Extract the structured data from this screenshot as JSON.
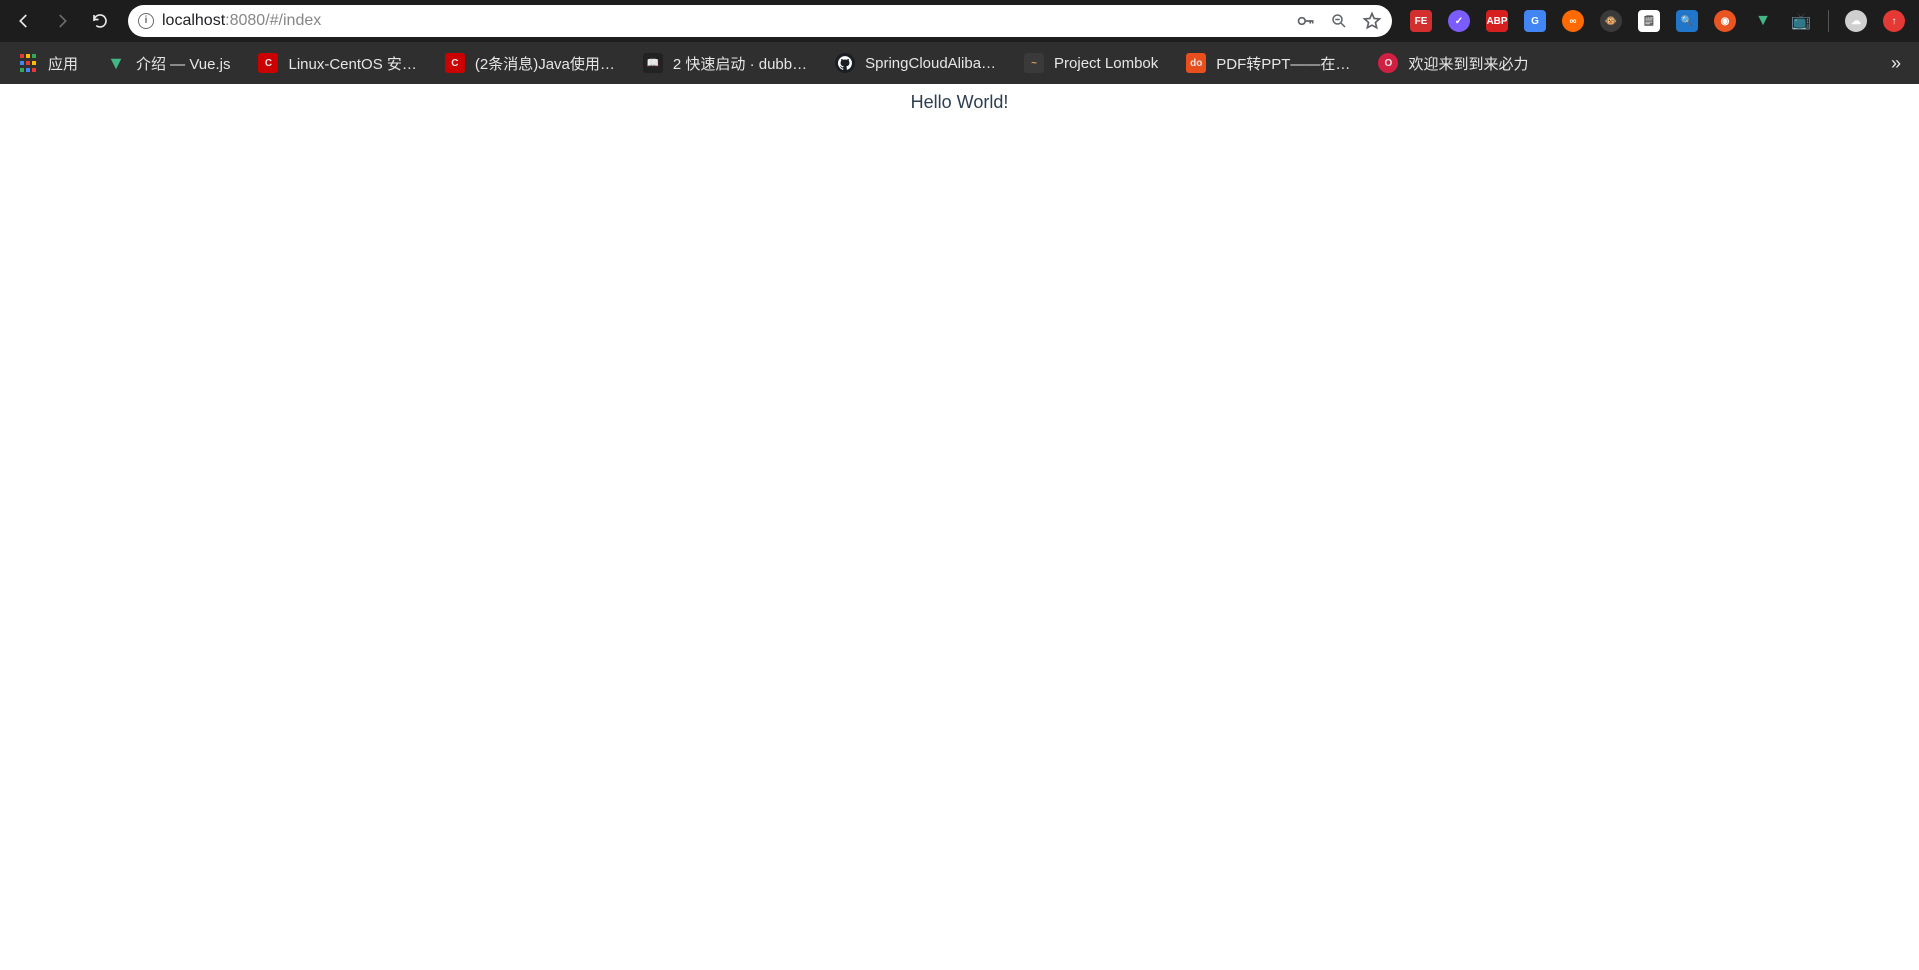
{
  "nav": {
    "url_prefix": "localhost",
    "url_suffix": ":8080/#/index"
  },
  "bookmarks": {
    "apps": "应用",
    "vue": "介绍 — Vue.js",
    "linux": "Linux-CentOS 安…",
    "java": "(2条消息)Java使用…",
    "dubbo": "2 快速启动 · dubb…",
    "spring": "SpringCloudAliba…",
    "lombok": "Project Lombok",
    "pdf": "PDF转PPT——在…",
    "bili": "欢迎来到到来必力"
  },
  "page": {
    "hello": "Hello World!"
  },
  "ext_labels": {
    "fe": "FE",
    "abp": "ABP",
    "do": "do",
    "g": "G"
  }
}
